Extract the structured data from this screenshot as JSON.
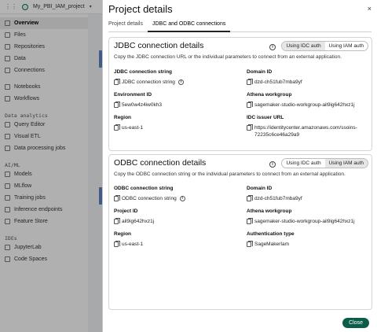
{
  "app": {
    "project_name": "My_PBI_IAM_project"
  },
  "sidebar": {
    "items_top": [
      {
        "label": "Overview",
        "active": true
      },
      {
        "label": "Files"
      },
      {
        "label": "Repositories"
      },
      {
        "label": "Data"
      },
      {
        "label": "Connections"
      }
    ],
    "items_mid": [
      {
        "label": "Notebooks"
      },
      {
        "label": "Workflows"
      }
    ],
    "section_analytics": "Data analytics",
    "items_analytics": [
      {
        "label": "Query Editor"
      },
      {
        "label": "Visual ETL"
      },
      {
        "label": "Data processing jobs"
      }
    ],
    "section_aiml": "AI/ML",
    "items_aiml": [
      {
        "label": "Models"
      },
      {
        "label": "MLflow"
      },
      {
        "label": "Training jobs"
      },
      {
        "label": "Inference endpoints"
      },
      {
        "label": "Feature Store"
      }
    ],
    "section_ides": "IDEs",
    "items_ides": [
      {
        "label": "JupyterLab"
      },
      {
        "label": "Code Spaces"
      }
    ]
  },
  "drawer": {
    "title": "Project details",
    "close_icon": "×",
    "tabs": [
      {
        "label": "Project details",
        "active": false
      },
      {
        "label": "JDBC and ODBC connections",
        "active": true
      }
    ],
    "close_button": "Close"
  },
  "jdbc": {
    "title": "JDBC connection details",
    "description": "Copy the JDBC connection URL or the individual parameters to connect from an external application.",
    "toggle": {
      "idc": "Using IDC auth",
      "iam": "Using IAM auth",
      "selected": "idc"
    },
    "connection_string": {
      "label": "JDBC connection string",
      "value": "JDBC connection string"
    },
    "domain_id": {
      "label": "Domain ID",
      "value": "dzd-ch51fub7mba9yf"
    },
    "environment_id": {
      "label": "Environment ID",
      "value": "5ew0w4z4iw0kh3"
    },
    "athena_workgroup": {
      "label": "Athena workgroup",
      "value": "sagemaker-studio-workgroup-ail9ig642hxz1j"
    },
    "region": {
      "label": "Region",
      "value": "us-east-1"
    },
    "idc_issuer_url": {
      "label": "IDC issuer URL",
      "value_line1": "https://identitycenter.amazonaws.com/ssoins-",
      "value_line2": "72235c6ce46a29a9"
    }
  },
  "odbc": {
    "title": "ODBC connection details",
    "description": "Copy the ODBC connection string or the individual parameters to connect from an external application.",
    "toggle": {
      "idc": "Using IDC auth",
      "iam": "Using IAM auth",
      "selected": "iam"
    },
    "connection_string": {
      "label": "ODBC connection string",
      "value": "ODBC connection string"
    },
    "domain_id": {
      "label": "Domain ID",
      "value": "dzd-ch51fub7mba9yf"
    },
    "project_id": {
      "label": "Project ID",
      "value": "ail9ig642hxz1j"
    },
    "athena_workgroup": {
      "label": "Athena workgroup",
      "value": "sagemaker-studio-workgroup-ail9ig642hxz1j"
    },
    "region": {
      "label": "Region",
      "value": "us-east-1"
    },
    "auth_type": {
      "label": "Authentication type",
      "value": "SageMakerIam"
    }
  }
}
